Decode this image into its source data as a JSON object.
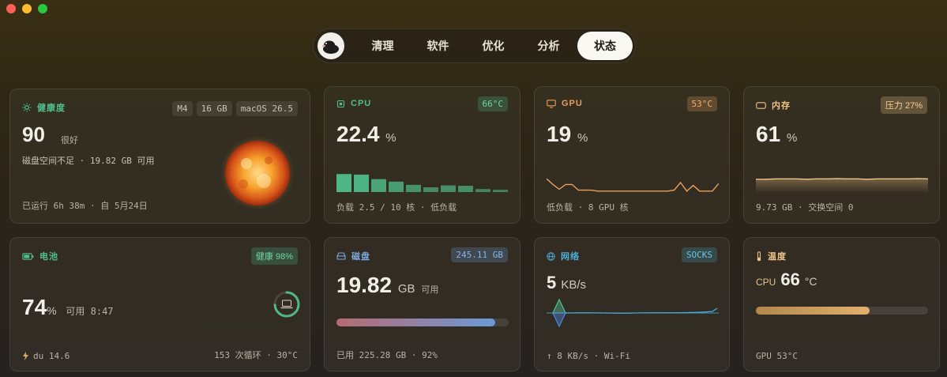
{
  "window": {
    "controls": [
      "close",
      "minimize",
      "zoom"
    ]
  },
  "tabs": [
    {
      "label": "清理",
      "active": false
    },
    {
      "label": "软件",
      "active": false
    },
    {
      "label": "优化",
      "active": false
    },
    {
      "label": "分析",
      "active": false
    },
    {
      "label": "状态",
      "active": true
    }
  ],
  "health": {
    "title": "健康度",
    "specs": [
      "M4",
      "16 GB",
      "macOS 26.5"
    ],
    "score": "90",
    "rating": "很好",
    "note": "磁盘空间不足 · 19.82 GB 可用",
    "uptime": "已运行 6h 38m · 自 5月24日"
  },
  "cpu": {
    "title": "CPU",
    "temp": "66°C",
    "value": "22.4",
    "unit": "%",
    "load_bars": [
      0.95,
      0.92,
      0.68,
      0.55,
      0.38,
      0.25,
      0.35,
      0.33,
      0.16,
      0.12
    ],
    "footer": "负载 2.5 / 10 核 · 低负载",
    "color": "#4fb88a"
  },
  "gpu": {
    "title": "GPU",
    "temp": "53°C",
    "value": "19",
    "unit": "%",
    "history": [
      0.7,
      0.4,
      0.15,
      0.4,
      0.4,
      0.1,
      0.1,
      0.1,
      0.05,
      0.05,
      0.05,
      0.05,
      0.05,
      0.05,
      0.05,
      0.05,
      0.05,
      0.05,
      0.05,
      0.05,
      0.1,
      0.5,
      0.05,
      0.35,
      0.05,
      0.05,
      0.05,
      0.45
    ],
    "footer": "低负载 · 8 GPU 核",
    "color": "#e8a05a"
  },
  "memory": {
    "title": "内存",
    "badge": "压力 27%",
    "value": "61",
    "unit": "%",
    "history": [
      0.6,
      0.6,
      0.61,
      0.61,
      0.61,
      0.6,
      0.61,
      0.61,
      0.62,
      0.61,
      0.61,
      0.6,
      0.61,
      0.61,
      0.61,
      0.61,
      0.62,
      0.61
    ],
    "footer": "9.73 GB · 交换空间 0",
    "color": "#f0c488"
  },
  "battery": {
    "title": "电池",
    "badge": "健康 98%",
    "value": "74",
    "unit": "%",
    "status": "可用 8:47",
    "level": 0.74,
    "source": "du 14.6",
    "cycles": "153 次循环 · 30°C",
    "color": "#4fb88a"
  },
  "disk": {
    "title": "磁盘",
    "badge": "245.11 GB",
    "value": "19.82",
    "unit": "GB",
    "unit_label": "可用",
    "used_fraction": 0.92,
    "footer": "已用 225.28 GB · 92%",
    "color": "#6a9ad8"
  },
  "network": {
    "title": "网络",
    "badge": "SOCKS",
    "value": "5",
    "unit": "KB/s",
    "footer": "↑ 8 KB/s · Wi-Fi",
    "color": "#4ab0d8"
  },
  "temperature": {
    "title": "温度",
    "label": "CPU",
    "value": "66",
    "unit": "°C",
    "level": 0.66,
    "footer": "GPU 53°C",
    "color": "#d8a868"
  }
}
